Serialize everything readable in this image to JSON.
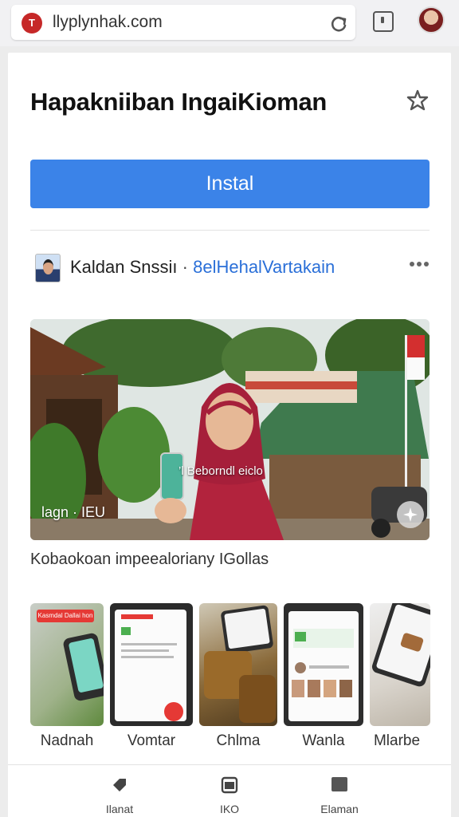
{
  "browser": {
    "url": "llyplynhak.com",
    "site_icon_text": "T"
  },
  "page": {
    "title": "Hapakniiban IngaiKioman",
    "install_label": "Instal",
    "author_name": "Kaldan Snssiı",
    "author_sep": "·",
    "author_link": "8elHehalVartakain",
    "hero_caption_left": "lagn · IEU",
    "hero_caption_banner": "’l Beborndl eiclo",
    "hero_description": "Kobaokoan impeealoriany IGollas"
  },
  "screenshots": [
    {
      "label": "Nadnah",
      "badge": "Kasmdal Dallai hon"
    },
    {
      "label": "Vomtar"
    },
    {
      "label": "Chlma"
    },
    {
      "label": "Wanla"
    },
    {
      "label": "Mlarbe"
    }
  ],
  "bottom_nav": [
    {
      "label": "Ilanat",
      "icon": "tag-icon"
    },
    {
      "label": "IKO",
      "icon": "window-icon"
    },
    {
      "label": "Elaman",
      "icon": "square-icon"
    }
  ],
  "colors": {
    "accent": "#3b83e8",
    "link": "#2a6fd8",
    "site_icon": "#c62828"
  }
}
